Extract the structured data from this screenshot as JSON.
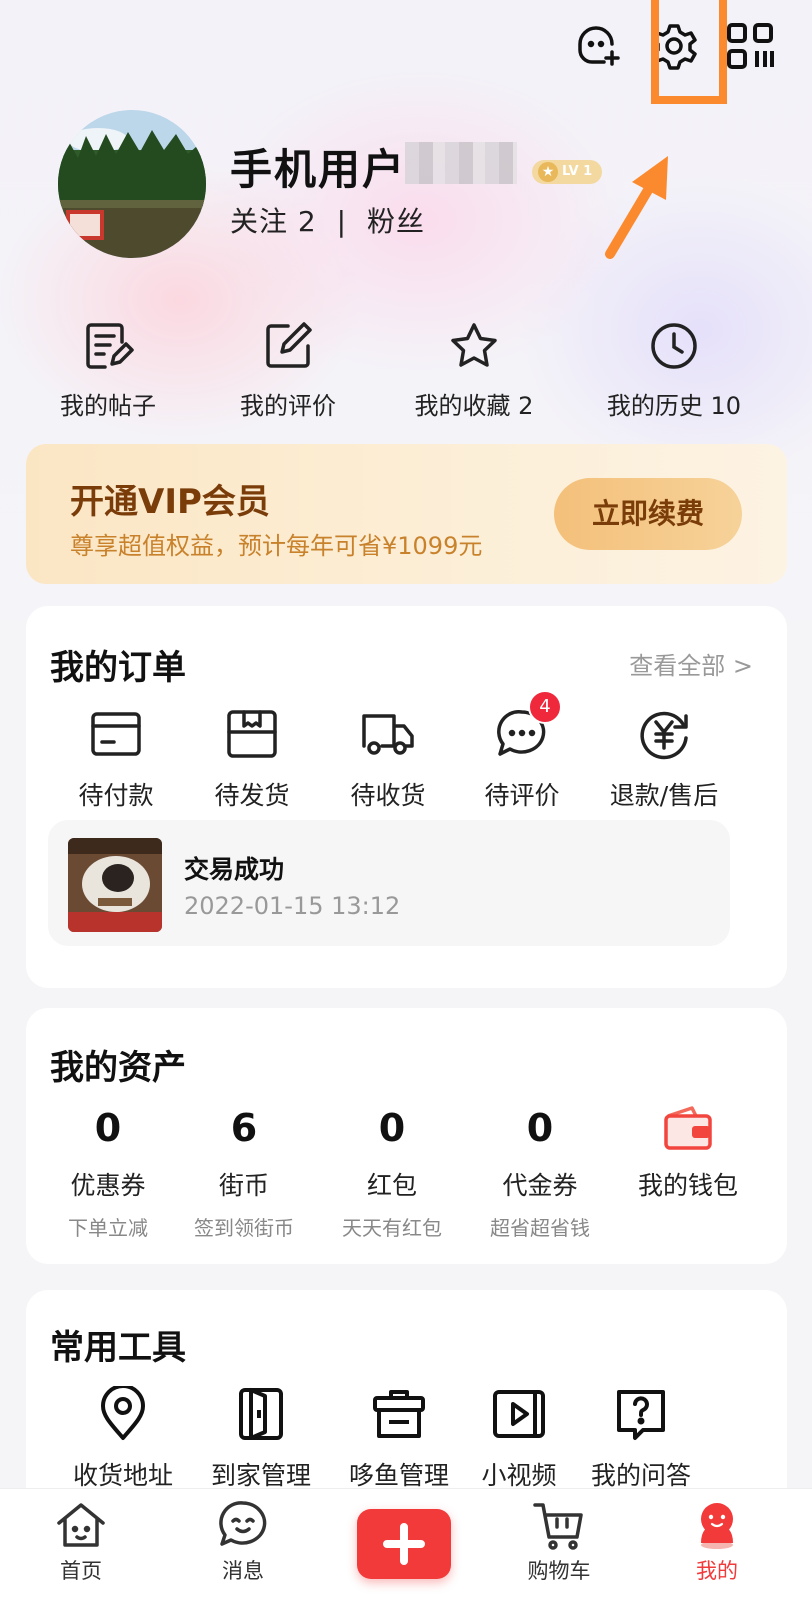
{
  "colors": {
    "accent_red": "#f33a3a",
    "highlight_orange": "#fb8a2e",
    "vip_brown": "#7a3d0a"
  },
  "header": {
    "icons": [
      "add-friend-icon",
      "gear-icon",
      "qr-code-icon"
    ]
  },
  "profile": {
    "username": "手机用户",
    "level": "LV 1",
    "following_label": "关注",
    "following_count": "2",
    "separator": "|",
    "fans_label": "粉丝"
  },
  "quick_links": [
    {
      "label": "我的帖子",
      "icon": "posts-icon"
    },
    {
      "label": "我的评价",
      "icon": "edit-icon"
    },
    {
      "label": "我的收藏 2",
      "icon": "star-icon"
    },
    {
      "label": "我的历史 10",
      "icon": "clock-icon"
    }
  ],
  "vip": {
    "title": "开通VIP会员",
    "subtitle": "尊享超值权益，预计每年可省¥1099元",
    "button": "立即续费"
  },
  "orders": {
    "title": "我的订单",
    "view_all": "查看全部 >",
    "items": [
      {
        "label": "待付款",
        "icon": "card-icon"
      },
      {
        "label": "待发货",
        "icon": "box-icon"
      },
      {
        "label": "待收货",
        "icon": "truck-icon"
      },
      {
        "label": "待评价",
        "icon": "chat-icon",
        "badge": "4"
      },
      {
        "label": "退款/售后",
        "icon": "refund-icon"
      }
    ],
    "latest": {
      "status": "交易成功",
      "time": "2022-01-15 13:12"
    }
  },
  "assets": {
    "title": "我的资产",
    "items": [
      {
        "value": "0",
        "name": "优惠券",
        "desc": "下单立减"
      },
      {
        "value": "6",
        "name": "街币",
        "desc": "签到领街币"
      },
      {
        "value": "0",
        "name": "红包",
        "desc": "天天有红包"
      },
      {
        "value": "0",
        "name": "代金券",
        "desc": "超省超省钱"
      }
    ],
    "wallet": {
      "name": "我的钱包",
      "icon": "wallet-icon"
    }
  },
  "tools": {
    "title": "常用工具",
    "items": [
      {
        "label": "收货地址",
        "icon": "location-icon"
      },
      {
        "label": "到家管理",
        "icon": "door-icon"
      },
      {
        "label": "哆鱼管理",
        "icon": "basket-icon"
      },
      {
        "label": "小视频",
        "icon": "video-icon"
      },
      {
        "label": "我的问答",
        "icon": "question-icon"
      }
    ]
  },
  "bottom_nav": [
    {
      "label": "首页",
      "icon": "home-icon"
    },
    {
      "label": "消息",
      "icon": "message-icon"
    },
    {
      "label": "",
      "icon": "plus-icon"
    },
    {
      "label": "购物车",
      "icon": "cart-icon"
    },
    {
      "label": "我的",
      "icon": "profile-icon",
      "active": true
    }
  ]
}
